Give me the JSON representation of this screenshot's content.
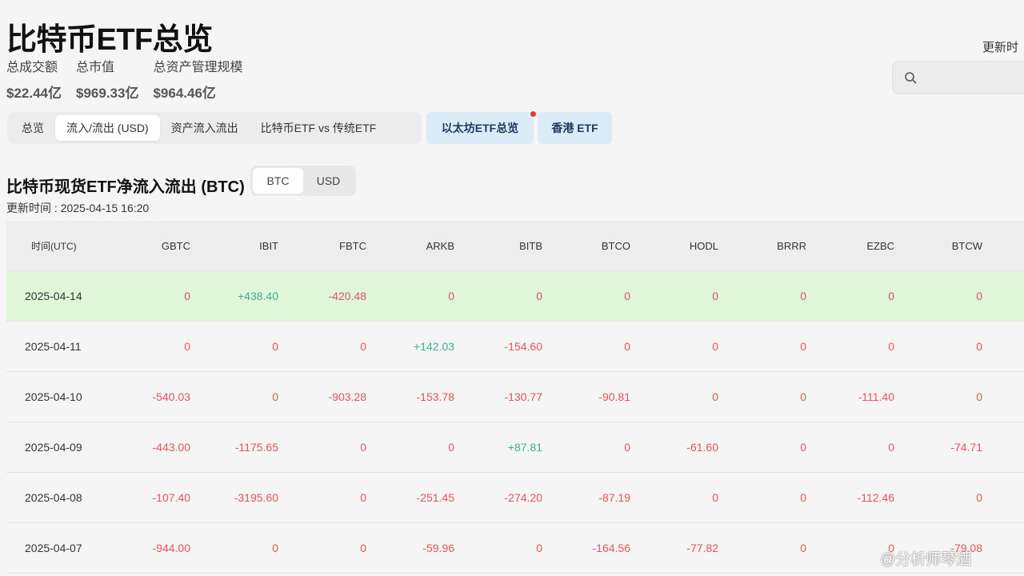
{
  "page": {
    "title": "比特币ETF总览",
    "updated_label": "更新时",
    "search_placeholder": ""
  },
  "stats": [
    {
      "label": "总成交额",
      "value": "$22.44亿"
    },
    {
      "label": "总市值",
      "value": "$969.33亿"
    },
    {
      "label": "总资产管理规模",
      "value": "$964.46亿"
    }
  ],
  "tabs": [
    {
      "label": "总览"
    },
    {
      "label": "流入/流出 (USD)"
    },
    {
      "label": "资产流入流出"
    },
    {
      "label": "比特币ETF vs 传统ETF"
    }
  ],
  "tab_eth": "以太坊ETF总览",
  "tab_hk": "香港 ETF",
  "section": {
    "title": "比特币现货ETF净流入流出 (BTC)",
    "toggle": [
      "BTC",
      "USD"
    ],
    "updated": "更新时间 : 2025-04-15 16:20"
  },
  "table": {
    "headers": [
      "时间(UTC)",
      "GBTC",
      "IBIT",
      "FBTC",
      "ARKB",
      "BITB",
      "BTCO",
      "HODL",
      "BRRR",
      "EZBC",
      "BTCW"
    ],
    "rows": [
      [
        "2025-04-14",
        "0",
        "+438.40",
        "-420.48",
        "0",
        "0",
        "0",
        "0",
        "0",
        "0",
        "0"
      ],
      [
        "2025-04-11",
        "0",
        "0",
        "0",
        "+142.03",
        "-154.60",
        "0",
        "0",
        "0",
        "0",
        "0"
      ],
      [
        "2025-04-10",
        "-540.03",
        "0",
        "-903.28",
        "-153.78",
        "-130.77",
        "-90.81",
        "0",
        "0",
        "-111.40",
        "0"
      ],
      [
        "2025-04-09",
        "-443.00",
        "-1175.65",
        "0",
        "0",
        "+87.81",
        "0",
        "-61.60",
        "0",
        "0",
        "-74.71"
      ],
      [
        "2025-04-08",
        "-107.40",
        "-3195.60",
        "0",
        "-251.45",
        "-274.20",
        "-87.19",
        "0",
        "0",
        "-112.46",
        "0"
      ],
      [
        "2025-04-07",
        "-944.00",
        "0",
        "0",
        "-59.96",
        "0",
        "-164.56",
        "-77.82",
        "0",
        "0",
        "-79.08"
      ]
    ]
  },
  "watermark": "@分析师琴酒",
  "colors": {
    "negative": "#e5535d",
    "positive": "#3fae8f",
    "highlight_row": "#dff7d8"
  }
}
